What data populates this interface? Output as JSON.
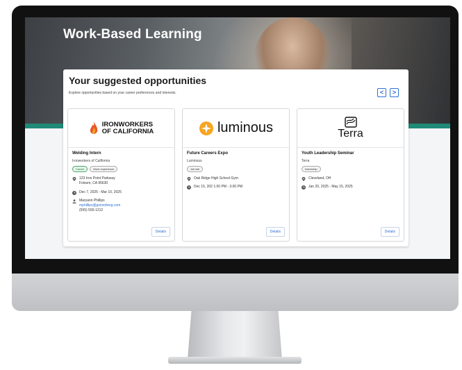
{
  "hero": {
    "title": "Work-Based Learning"
  },
  "section": {
    "title": "Your suggested opportunities",
    "subtitle": "Explore opportunities based on your career preferences and interests.",
    "prev_label": "<",
    "next_label": ">"
  },
  "cards": [
    {
      "logo_line1": "IRONWORKERS",
      "logo_line2": "OF CALIFORNIA",
      "title": "Welding Intern",
      "org": "Ironworkers of California",
      "tags": [
        "Career",
        "Work experience"
      ],
      "address_line1": "123 Iron Point Parkway",
      "address_line2": "Folsom, CA 95630",
      "dates": "Dec 7, 2025 - Mar 10, 2025",
      "contact_name": "Maryann Phillips",
      "contact_email": "mphillips@goinerberg.com",
      "contact_phone": "(555) 555-1212",
      "details_label": "Details"
    },
    {
      "logo_text": "luminous",
      "title": "Future Careers Expo",
      "org": "Luminous",
      "tags": [
        "Job fair"
      ],
      "location": "Oak Ridge High School Gym",
      "dates": "Dec 15, 202  1:00 PM - 3:00 PM",
      "details_label": "Details"
    },
    {
      "logo_text": "Terra",
      "title": "Youth Leadership Seminar",
      "org": "Terra",
      "tags": [
        "Internship"
      ],
      "location": "Cleveland, OH",
      "dates": "Jan 20, 2025 - May 15, 2025",
      "details_label": "Details"
    }
  ],
  "colors": {
    "accent": "#2b6fd6",
    "teal": "#1f8a78",
    "orange": "#f5a623"
  }
}
